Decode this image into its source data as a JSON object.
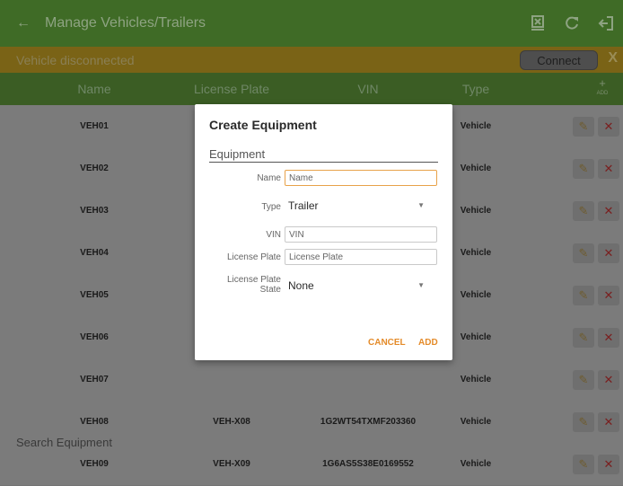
{
  "appbar": {
    "back_icon": "arrow-back-icon",
    "title": "Manage Vehicles/Trailers",
    "actions": [
      "export-icon",
      "refresh-icon",
      "logout-icon"
    ]
  },
  "banner": {
    "message": "Vehicle disconnected",
    "connect_label": "Connect",
    "close_label": "X"
  },
  "table": {
    "headers": [
      "Name",
      "License Plate",
      "VIN",
      "Type"
    ],
    "add_plus": "+",
    "add_label": "ADD",
    "rows": [
      {
        "name": "VEH01",
        "plate": "",
        "vin": "",
        "type": "Vehicle"
      },
      {
        "name": "VEH02",
        "plate": "",
        "vin": "",
        "type": "Vehicle"
      },
      {
        "name": "VEH03",
        "plate": "",
        "vin": "",
        "type": "Vehicle"
      },
      {
        "name": "VEH04",
        "plate": "",
        "vin": "",
        "type": "Vehicle"
      },
      {
        "name": "VEH05",
        "plate": "",
        "vin": "",
        "type": "Vehicle"
      },
      {
        "name": "VEH06",
        "plate": "",
        "vin": "",
        "type": "Vehicle"
      },
      {
        "name": "VEH07",
        "plate": "",
        "vin": "",
        "type": "Vehicle"
      },
      {
        "name": "VEH08",
        "plate": "VEH-X08",
        "vin": "1G2WT54TXMF203360",
        "type": "Vehicle"
      },
      {
        "name": "VEH09",
        "plate": "VEH-X09",
        "vin": "1G6AS5S38E0169552",
        "type": "Vehicle"
      }
    ],
    "edit_glyph": "✎",
    "delete_glyph": "✕"
  },
  "search": {
    "placeholder": "Search Equipment"
  },
  "dialog": {
    "title": "Create Equipment",
    "section": "Equipment",
    "name_label": "Name",
    "name_placeholder": "Name",
    "type_label": "Type",
    "type_value": "Trailer",
    "vin_label": "VIN",
    "vin_placeholder": "VIN",
    "plate_label": "License Plate",
    "plate_placeholder": "License Plate",
    "state_label_1": "License Plate",
    "state_label_2": "State",
    "state_value": "None",
    "cancel_label": "CANCEL",
    "add_label": "ADD"
  },
  "colors": {
    "appbar": "#3f6b26",
    "banner": "#7a6316",
    "accent": "#e48b2a",
    "delete": "#7a1f1f"
  }
}
